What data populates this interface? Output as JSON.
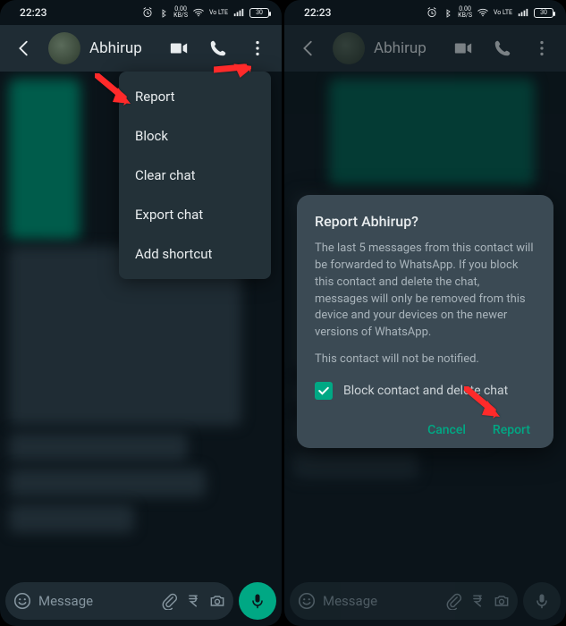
{
  "status": {
    "time": "22:23",
    "kbps_top": "0.00",
    "kbps_bottom": "KB/S",
    "net": "Vo LTE",
    "battery": "30"
  },
  "header": {
    "contact": "Abhirup"
  },
  "menu": {
    "items": [
      "Report",
      "Block",
      "Clear chat",
      "Export chat",
      "Add shortcut"
    ]
  },
  "input": {
    "placeholder": "Message"
  },
  "dialog": {
    "title": "Report Abhirup?",
    "body": "The last 5 messages from this contact will be forwarded to WhatsApp. If you block this contact and delete the chat, messages will only be removed from this device and your devices on the newer versions of WhatsApp.",
    "note": "This contact will not be notified.",
    "checkbox_label": "Block contact and delete chat",
    "cancel": "Cancel",
    "confirm": "Report"
  }
}
